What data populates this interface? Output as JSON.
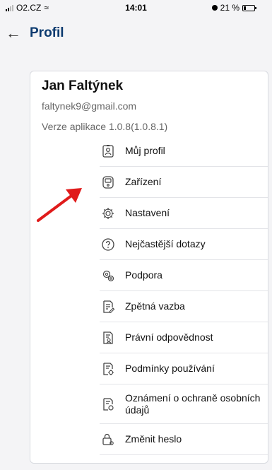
{
  "status_bar": {
    "carrier": "O2.CZ",
    "time": "14:01",
    "battery_percent": "21 %"
  },
  "header": {
    "title": "Profil"
  },
  "profile": {
    "name": "Jan Faltýnek",
    "email": "faltynek9@gmail.com",
    "version": "Verze aplikace 1.0.8(1.0.8.1)"
  },
  "menu": {
    "items": [
      {
        "label": "Můj profil",
        "icon": "person-id-icon"
      },
      {
        "label": "Zařízení",
        "icon": "device-icon"
      },
      {
        "label": "Nastavení",
        "icon": "gear-icon"
      },
      {
        "label": "Nejčastější dotazy",
        "icon": "question-icon"
      },
      {
        "label": "Podpora",
        "icon": "support-icon"
      },
      {
        "label": "Zpětná vazba",
        "icon": "feedback-icon"
      },
      {
        "label": "Právní odpovědnost",
        "icon": "legal-icon"
      },
      {
        "label": "Podmínky používání",
        "icon": "terms-icon"
      },
      {
        "label": "Oznámení o ochraně osobních údajů",
        "icon": "privacy-icon"
      },
      {
        "label": "Změnit heslo",
        "icon": "lock-icon"
      }
    ]
  },
  "colors": {
    "title": "#0b3a6f",
    "arrow": "#e01b1b"
  }
}
